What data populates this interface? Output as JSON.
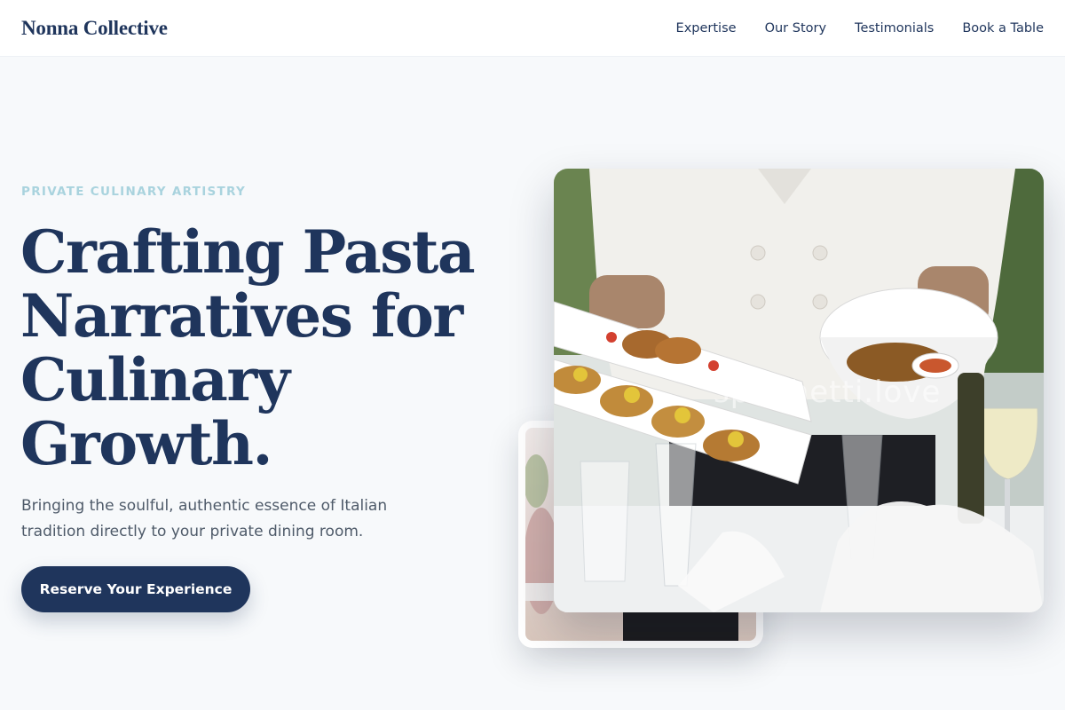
{
  "header": {
    "brand": "Nonna Collective",
    "nav": [
      {
        "label": "Expertise"
      },
      {
        "label": "Our Story"
      },
      {
        "label": "Testimonials"
      },
      {
        "label": "Book a Table"
      }
    ]
  },
  "hero": {
    "eyebrow": "PRIVATE CULINARY ARTISTRY",
    "headline": [
      "Crafting Pasta",
      "Narratives for",
      "Culinary",
      "Growth."
    ],
    "subtitle": "Bringing the soulful, authentic essence of Italian tradition directly to your private dining room.",
    "cta_label": "Reserve Your Experience",
    "watermark": "spaghetti.love"
  },
  "colors": {
    "primary": "#1f355c",
    "eyebrow": "#a9d3de",
    "background": "#f7f9fb",
    "body_text": "#4e5a69"
  }
}
